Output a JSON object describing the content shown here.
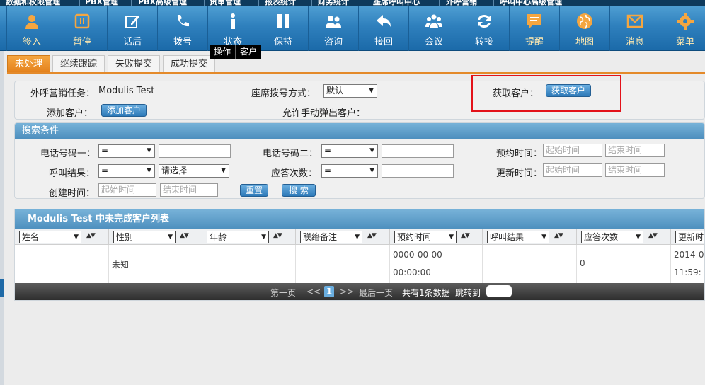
{
  "topmenu": [
    "数据和权限管理",
    "PBX管理",
    "PBX高级管理",
    "资审管理",
    "报表统计",
    "财务统计",
    "座席呼叫中心",
    "外呼营销",
    "呼叫中心高级管理"
  ],
  "toolbar": [
    {
      "label": "签入",
      "icon": "person-icon"
    },
    {
      "label": "暂停",
      "icon": "pause-box-icon"
    },
    {
      "label": "话后",
      "icon": "edit-icon"
    },
    {
      "label": "拨号",
      "icon": "phone-icon"
    },
    {
      "label": "状态",
      "icon": "info-icon"
    },
    {
      "label": "保持",
      "icon": "hold-icon"
    },
    {
      "label": "咨询",
      "icon": "consult-icon"
    },
    {
      "label": "接回",
      "icon": "return-icon"
    },
    {
      "label": "会议",
      "icon": "conference-icon"
    },
    {
      "label": "转接",
      "icon": "transfer-icon"
    },
    {
      "label": "提醒",
      "icon": "reminder-icon"
    },
    {
      "label": "地图",
      "icon": "globe-icon"
    },
    {
      "label": "消息",
      "icon": "mail-icon"
    },
    {
      "label": "菜单",
      "icon": "gear-icon"
    }
  ],
  "tooltip": [
    "操作",
    "客户"
  ],
  "tabs": [
    "未处理",
    "继续跟踪",
    "失败提交",
    "成功提交"
  ],
  "task": {
    "task_label": "外呼营销任务：",
    "task_value": "Modulis Test",
    "dial_label": "座席拨号方式：",
    "dial_value": "默认",
    "fetch_label": "获取客户：",
    "fetch_btn": "获取客户",
    "add_label": "添加客户：",
    "add_btn": "添加客户",
    "popup_label": "允许手动弹出客户："
  },
  "search": {
    "title": "搜索条件",
    "phone1_label": "电话号码一：",
    "phone2_label": "电话号码二：",
    "appt_label": "预约时间：",
    "result_label": "呼叫结果：",
    "answer_label": "应答次数：",
    "update_label": "更新时间：",
    "created_label": "创建时间：",
    "op_eq": "=",
    "choose": "请选择",
    "start_ph": "起始时间",
    "end_ph": "结束时间",
    "reset_btn": "重置",
    "search_btn": "搜 索"
  },
  "grid": {
    "title": "Modulis Test 中未完成客户列表",
    "columns": [
      "姓名",
      "性别",
      "年龄",
      "联络备注",
      "预约时间",
      "呼叫结果",
      "应答次数",
      "更新时间"
    ],
    "row": {
      "gender": "未知",
      "appt_date": "0000-00-00",
      "appt_time": "00:00:00",
      "answer": "0",
      "update_date": "2014-0",
      "update_time": "11:59:"
    },
    "pager": {
      "first": "第一页",
      "prev": "<<",
      "current": "1",
      "next": ">>",
      "last": "最后一页",
      "total": "共有1条数据",
      "jump": "跳转到"
    }
  },
  "colors": {
    "accent": "#e3801b",
    "blue": "#2f80bd",
    "highlight": "#e3121a"
  }
}
